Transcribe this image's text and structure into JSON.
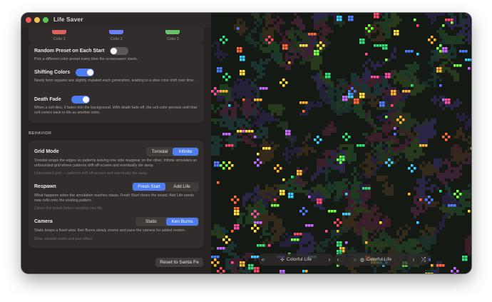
{
  "window": {
    "title": "Life Saver"
  },
  "colors": {
    "color1": "#d8625f",
    "color2": "#6d7ef0",
    "color3": "#67c26a",
    "accent": "#4d7df0"
  },
  "colors_card": {
    "labels": [
      "Color 1",
      "Color 2",
      "Color 3"
    ]
  },
  "random_preset": {
    "title": "Random Preset on Each Start",
    "description": "Pick a different color preset every time the screensaver starts.",
    "enabled": false
  },
  "shifting_colors": {
    "title": "Shifting Colors",
    "description": "Newly born squares are slightly mutated each generation, leading to a slow color shift over time.",
    "enabled": true
  },
  "death_fade": {
    "title": "Death Fade",
    "description": "When a cell dies, it fades into the background. With death fade off, the cell color persists until that cell comes back to life as another color.",
    "enabled": true
  },
  "behavior": {
    "heading": "BEHAVIOR",
    "grid_mode": {
      "title": "Grid Mode",
      "options": [
        "Toroidal",
        "Infinite"
      ],
      "selected": "Infinite",
      "description": "Toroidal wraps the edges so patterns leaving one side reappear on the other. Infinite simulates an unbounded grid where patterns drift off-screen and eventually die away.",
      "note": "Unbounded grid — patterns drift off-screen and eventually die away."
    },
    "respawn": {
      "title": "Respawn",
      "options": [
        "Fresh Start",
        "Add Life"
      ],
      "selected": "Fresh Start",
      "description": "What happens when the simulation reaches stasis. Fresh Start clears the board; Add Life seeds new cells onto the existing pattern.",
      "note": "Clears the board before seeding new life."
    },
    "camera": {
      "title": "Camera",
      "options": [
        "Static",
        "Ken Burns"
      ],
      "selected": "Ken Burns",
      "description": "Static keeps a fixed view. Ken Burns slowly zooms and pans the camera for added motion.",
      "note": "Slow, smooth zoom and pan effect."
    }
  },
  "reset_button": "Reset to Santa Fe",
  "preview_bar": {
    "preset_a": "Colorful Life",
    "preset_b": "Colorful Life",
    "prev_icon": "chevron-left-icon",
    "next_icon": "chevron-right-icon",
    "shuffle_icon": "shuffle-icon"
  }
}
